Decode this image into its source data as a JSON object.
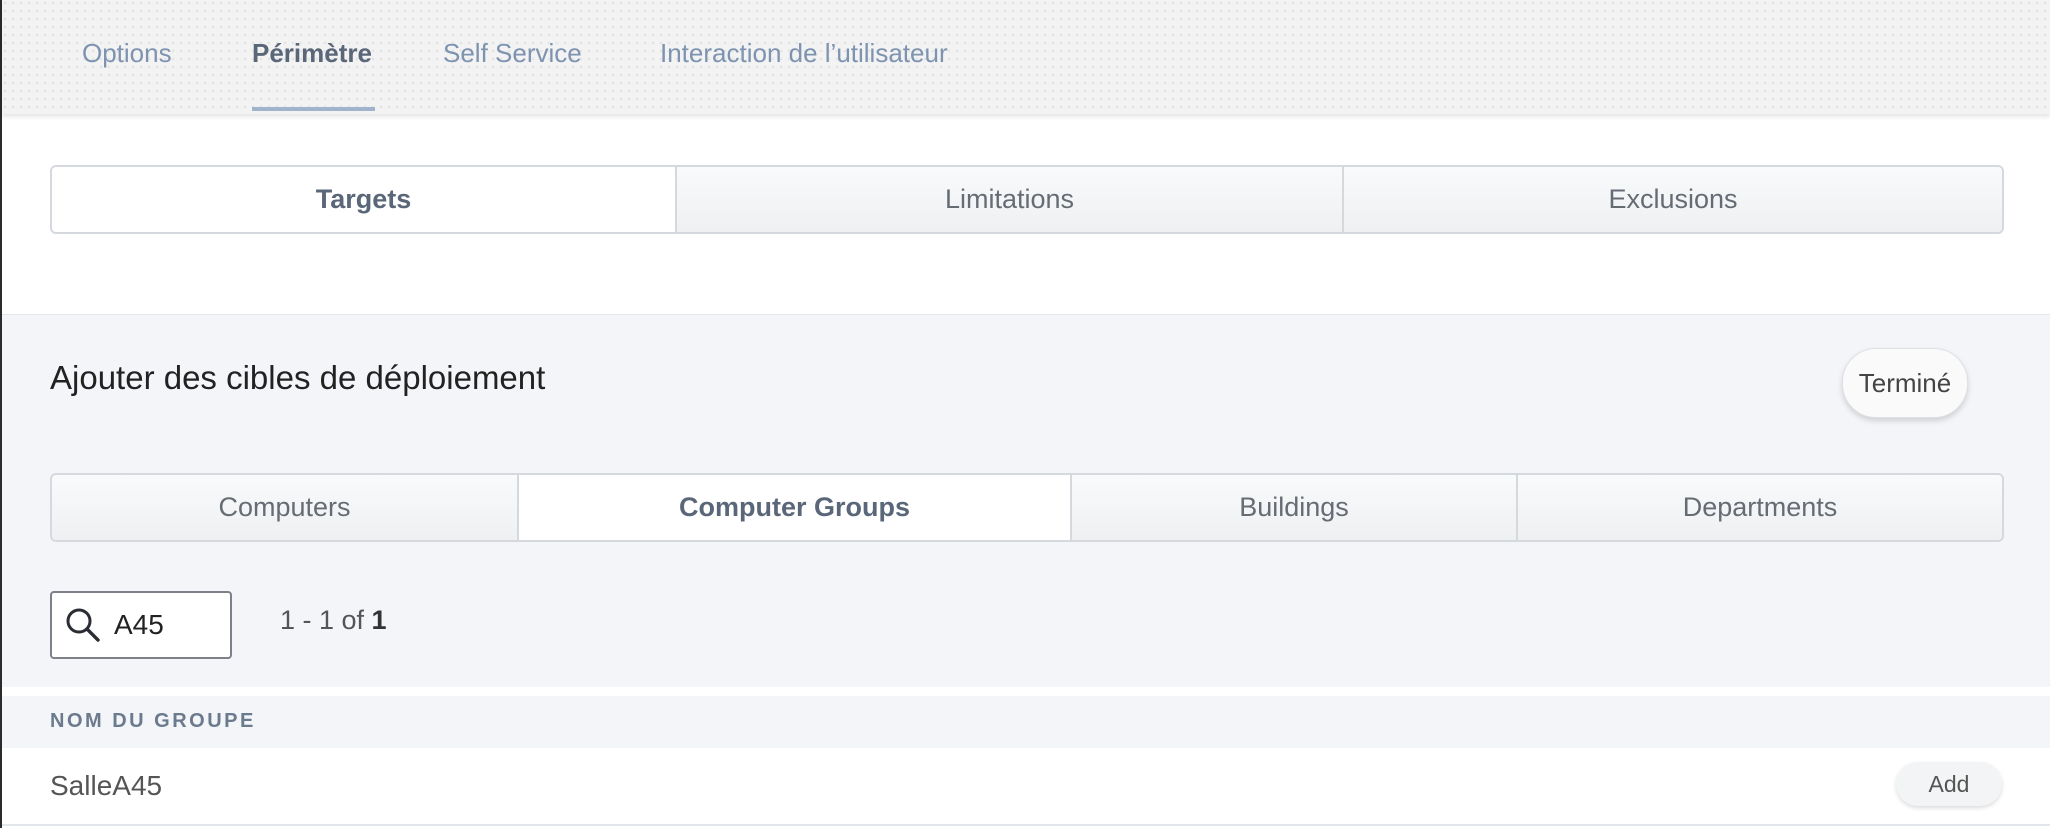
{
  "top_tabs": [
    {
      "label": "Options"
    },
    {
      "label": "Périmètre"
    },
    {
      "label": "Self Service"
    },
    {
      "label": "Interaction de l’utilisateur"
    }
  ],
  "scope_tabs": [
    {
      "label": "Targets"
    },
    {
      "label": "Limitations"
    },
    {
      "label": "Exclusions"
    }
  ],
  "panel": {
    "title": "Ajouter des cibles de déploiement",
    "done_label": "Terminé"
  },
  "target_tabs": [
    {
      "label": "Computers"
    },
    {
      "label": "Computer Groups"
    },
    {
      "label": "Buildings"
    },
    {
      "label": "Departments"
    }
  ],
  "search": {
    "value": "A45",
    "icon": "search-icon"
  },
  "pagination": {
    "range": "1 - 1 of ",
    "total": "1"
  },
  "table": {
    "column_header": "NOM DU GROUPE",
    "rows": [
      {
        "name": "SalleA45",
        "action": "Add"
      }
    ]
  },
  "colors": {
    "accent": "#9fb4cc",
    "tab_text": "#7d93b0",
    "panel_bg": "#f3f5f8"
  }
}
